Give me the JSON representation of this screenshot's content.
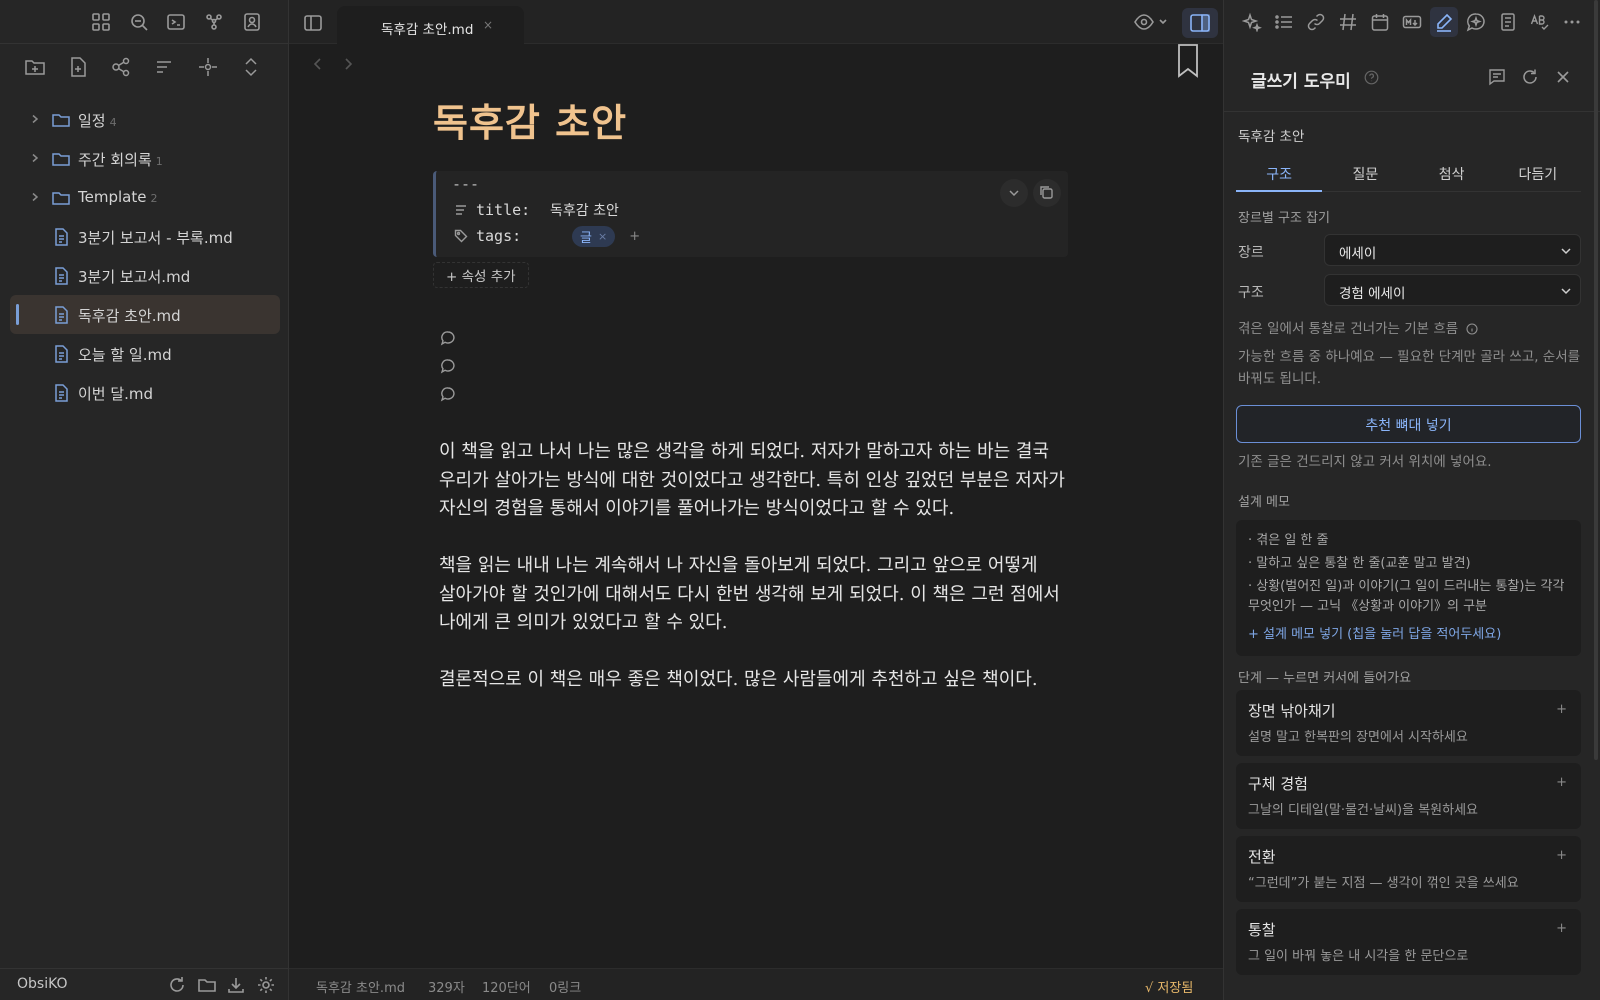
{
  "vault": {
    "name": "ObsiKO"
  },
  "file_tree": [
    {
      "type": "folder",
      "label": "일정",
      "count": "4"
    },
    {
      "type": "folder",
      "label": "주간 회의록",
      "count": "1"
    },
    {
      "type": "folder",
      "label": "Template",
      "count": "2"
    },
    {
      "type": "file",
      "label": "3분기 보고서 - 부록.md"
    },
    {
      "type": "file",
      "label": "3분기 보고서.md"
    },
    {
      "type": "file",
      "label": "독후감 초안.md",
      "active": true
    },
    {
      "type": "file",
      "label": "오늘 할 일.md"
    },
    {
      "type": "file",
      "label": "이번 달.md"
    }
  ],
  "tab": {
    "title": "독후감 초안.md",
    "close": "×"
  },
  "document": {
    "title": "독후감 초안",
    "frontmatter_dashes": "---",
    "prop_title_key": "title:",
    "prop_title_value": "독후감 초안",
    "prop_tags_key": "tags:",
    "tag": "글",
    "tag_remove": "×",
    "tag_add": "+",
    "add_property": "+ 속성 추가",
    "paragraphs": [
      "이 책을 읽고 나서 나는 많은 생각을 하게 되었다. 저자가 말하고자 하는 바는 결국\n우리가 살아가는 방식에 대한 것이었다고 생각한다. 특히 인상 깊었던 부분은 저자가\n자신의 경험을 통해서 이야기를 풀어나가는 방식이었다고 할 수 있다.",
      "책을 읽는 내내 나는 계속해서 나 자신을 돌아보게 되었다. 그리고 앞으로 어떻게\n살아가야 할 것인가에 대해서도 다시 한번 생각해 보게 되었다. 이 책은 그런 점에서\n나에게 큰 의미가 있었다고 할 수 있다.",
      "결론적으로 이 책은 매우 좋은 책이었다. 많은 사람들에게 추천하고 싶은 책이다."
    ]
  },
  "status_bar": {
    "file": "독후감 초안.md",
    "chars": "329자",
    "words": "120단어",
    "links": "0링크",
    "saved": "√ 저장됨"
  },
  "panel": {
    "title": "글쓰기 도우미",
    "note_name": "독후감 초안",
    "tabs": [
      "구조",
      "질문",
      "첨삭",
      "다듬기"
    ],
    "active_tab": "구조",
    "section_genre": "장르별 구조 잡기",
    "genre_label": "장르",
    "genre_value": "에세이",
    "structure_label": "구조",
    "structure_value": "경험 에세이",
    "flow_hint": "겪은 일에서 통찰로 건너가는 기본 흐름",
    "flow_note": "가능한 흐름 중 하나예요 — 필요한 단계만 골라 쓰고, 순서를 바꿔도 됩니다.",
    "insert_button": "추천 뼈대 넣기",
    "insert_hint": "기존 글은 건드리지 않고 커서 위치에 넣어요.",
    "memo_label": "설계 메모",
    "memo_items": [
      "· 겪은 일 한 줄",
      "· 말하고 싶은 통찰 한 줄(교훈 말고 발견)",
      "· 상황(벌어진 일)과 이야기(그 일이 드러내는 통찰)는 각각 무엇인가 — 고닉 《상황과 이야기》의 구분"
    ],
    "memo_add": "+ 설계 메모 넣기 (칩을 눌러 답을 적어두세요)",
    "steps_label": "단계 — 누르면 커서에 들어가요",
    "steps": [
      {
        "title": "장면 낚아채기",
        "desc": "설명 말고 한복판의 장면에서 시작하세요"
      },
      {
        "title": "구체 경험",
        "desc": "그날의 디테일(말·물건·날씨)을 복원하세요"
      },
      {
        "title": "전환",
        "desc": "“그런데”가 붙는 지점 — 생각이 꺾인 곳을 쓰세요"
      },
      {
        "title": "통찰",
        "desc": "그 일이 바꿔 놓은 내 시각을 한 문단으로"
      }
    ],
    "step_plus": "+"
  },
  "colors": {
    "accent": "#8ab4f8",
    "title": "#f0c38e",
    "saved": "#e8b86a",
    "folder": "#7a9ed6"
  }
}
